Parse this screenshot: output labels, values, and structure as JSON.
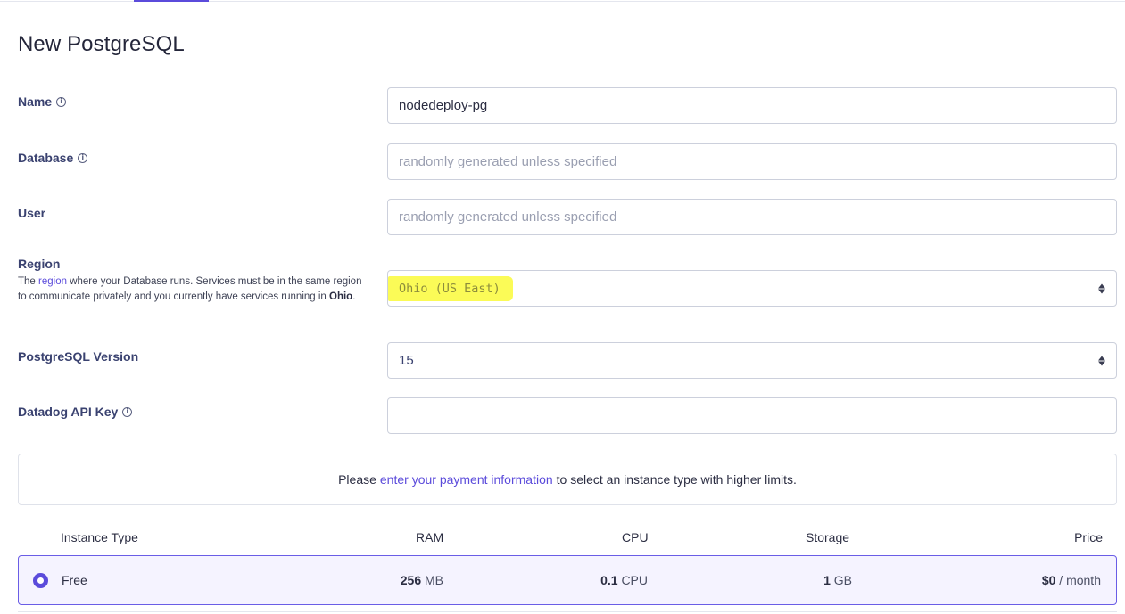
{
  "page": {
    "title": "New PostgreSQL"
  },
  "form": {
    "name": {
      "label": "Name",
      "value": "nodedeploy-pg"
    },
    "database": {
      "label": "Database",
      "placeholder": "randomly generated unless specified"
    },
    "user": {
      "label": "User",
      "placeholder": "randomly generated unless specified"
    },
    "region": {
      "label": "Region",
      "desc_prefix": "The",
      "desc_link": "region",
      "desc_middle": "where your Database runs. Services must be in the same region to communicate privately and you currently have services running in",
      "desc_bold": "Ohio",
      "desc_suffix": ".",
      "value": "Ohio (US East)"
    },
    "version": {
      "label": "PostgreSQL Version",
      "value": "15"
    },
    "datadog": {
      "label": "Datadog API Key",
      "value": ""
    }
  },
  "notice": {
    "prefix": "Please",
    "link": "enter your payment information",
    "suffix": "to select an instance type with higher limits."
  },
  "instance_table": {
    "headers": {
      "type": "Instance Type",
      "ram": "RAM",
      "cpu": "CPU",
      "storage": "Storage",
      "price": "Price"
    },
    "rows": [
      {
        "name": "Free",
        "ram_value": "256",
        "ram_unit": "MB",
        "cpu_value": "0.1",
        "cpu_unit": "CPU",
        "storage_value": "1",
        "storage_unit": "GB",
        "price_value": "$0",
        "price_unit": "/ month",
        "selected": true
      }
    ]
  },
  "colors": {
    "accent": "#5b4bdb",
    "highlight": "#fbfb57",
    "selected_bg": "#f5f3ff"
  }
}
